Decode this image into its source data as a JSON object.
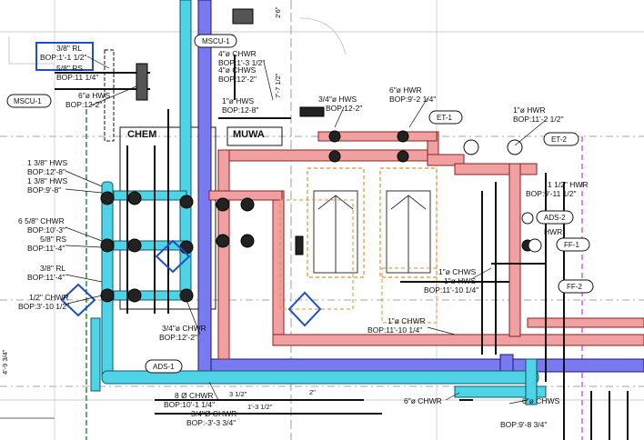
{
  "colors": {
    "chwr": "#4fd3e6",
    "hws": "#7a7af0",
    "hwr": "#f0a0a0",
    "steel": "#1a1a1a",
    "highlight": "#1f4fc8",
    "magenta": "#c040c0",
    "equip_dash": "#e09030"
  },
  "zones": {
    "chem": "CHEM",
    "muwa": "MUWA"
  },
  "tags": {
    "mscu1_top": "MSCU-1",
    "mscu1_left": "MSCU-1",
    "et1": "ET-1",
    "et2": "ET-2",
    "ads1": "ADS-1",
    "ads2": "ADS-2",
    "ff1": "FF-1",
    "ff2": "FF-2"
  },
  "labels": {
    "rl_top": "3/8\" RL",
    "rl_top_bop": "BOP:1'-1 1/2\"",
    "rs_top": "5/8\" RS",
    "rs_top_bop": "BOP:11 1/4\"",
    "hws_small": "6\"ø HWS",
    "hws_small_bop": "BOP:12-2\"",
    "chwr_top": "4\"ø CHWR",
    "chwr_top_bop": "BOP:1'-3 1/2\"",
    "chws_top": "4\"ø CHWS",
    "chws_top_bop": "BOP:12'-2\"",
    "hws_1": "1\"ø HWS",
    "hws_1_bop": "BOP:12-8\"",
    "hws_34": "3/4\"ø HWS",
    "hws_34_bop": "BOP:12-2\"",
    "hwr_6": "6\"ø HWR",
    "hwr_6_bop": "BOP:9'-2 1/4\"",
    "hwr_1": "1\"ø HWR",
    "hwr_1_bop": "BOP:11'-2 1/2\"",
    "hws_138a": "1 3/8\" HWS",
    "hws_138a_bop": "BOP:12'-8\"",
    "hws_138b": "1 3/8\" HWS",
    "hws_138b_bop": "BOP:9'-8\"",
    "chwr_658": "6 5/8\" CHWR",
    "chwr_658_bop": "BOP:10'-3\"",
    "rs_58": "5/8\" RS",
    "rs_58_bop": "BOP:11'-4\"",
    "rl_38": "3/8\" RL",
    "rl_38_bop": "BOP:11'-4\"",
    "chwr_12": "1/2\" CHWR",
    "chwr_12_bop": "BOP:3'-10 1/2\"",
    "chwr_34": "3/4\"ø CHWR",
    "chwr_34_bop": "BOP:12'-2\"",
    "chws_1a": "1\"ø CHWS",
    "chws_1b": "1\"ø HWS",
    "chws_1_bop": "BOP:11'-10 1/4\"",
    "chwr_1": "1\"ø CHWR",
    "chwr_1_bop": "BOP:11'-10 1/4\"",
    "chwr_8": "8 Ø CHWR",
    "chwr_8_bop": "BOP:10'-1 1/4\"",
    "chwr_34b": "3/4\"Ø CHWR",
    "chwr_34b_bop": "BOP:-3'-3 3/4\"",
    "chwr_6b": "6\"ø CHWR",
    "chws_6": "6\"ø CHWS",
    "chws_6_bop": "BOP:9'-8 3/4\"",
    "hwr_right": "1 1/2\" HWR",
    "hwr_right_bop": "BOP:9'-11 1/2\"",
    "hwr_right2": "HWR",
    "dim_1": "3 1/2\"",
    "dim_2": "1'-3 1/2\"",
    "dim_3": "2\"",
    "dim_left": "4'-9 3/4\"",
    "dim_top1": "7'-7 1/2\"",
    "dim_top2": "2'6\""
  }
}
